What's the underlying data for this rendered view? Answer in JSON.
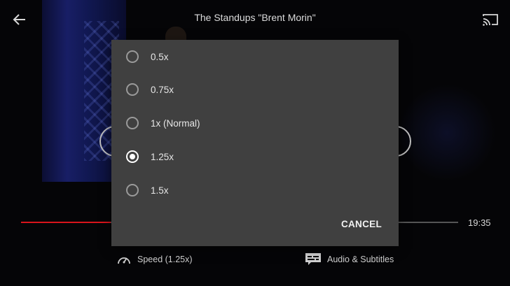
{
  "player": {
    "title": "The Standups  \"Brent Morin\"",
    "time_remaining": "19:35",
    "progress_fraction": 0.205,
    "accent_color": "#d9141b"
  },
  "icons": {
    "back": "arrow-left-icon",
    "cast": "cast-icon",
    "speed": "speedometer-icon",
    "audio_subtitles": "subtitles-icon"
  },
  "controls": {
    "speed_label": "Speed (1.25x)",
    "audio_label": "Audio & Subtitles"
  },
  "speed_dialog": {
    "options": [
      {
        "label": "0.5x",
        "selected": false
      },
      {
        "label": "0.75x",
        "selected": false
      },
      {
        "label": "1x (Normal)",
        "selected": false
      },
      {
        "label": "1.25x",
        "selected": true
      },
      {
        "label": "1.5x",
        "selected": false
      }
    ],
    "cancel_label": "CANCEL"
  }
}
